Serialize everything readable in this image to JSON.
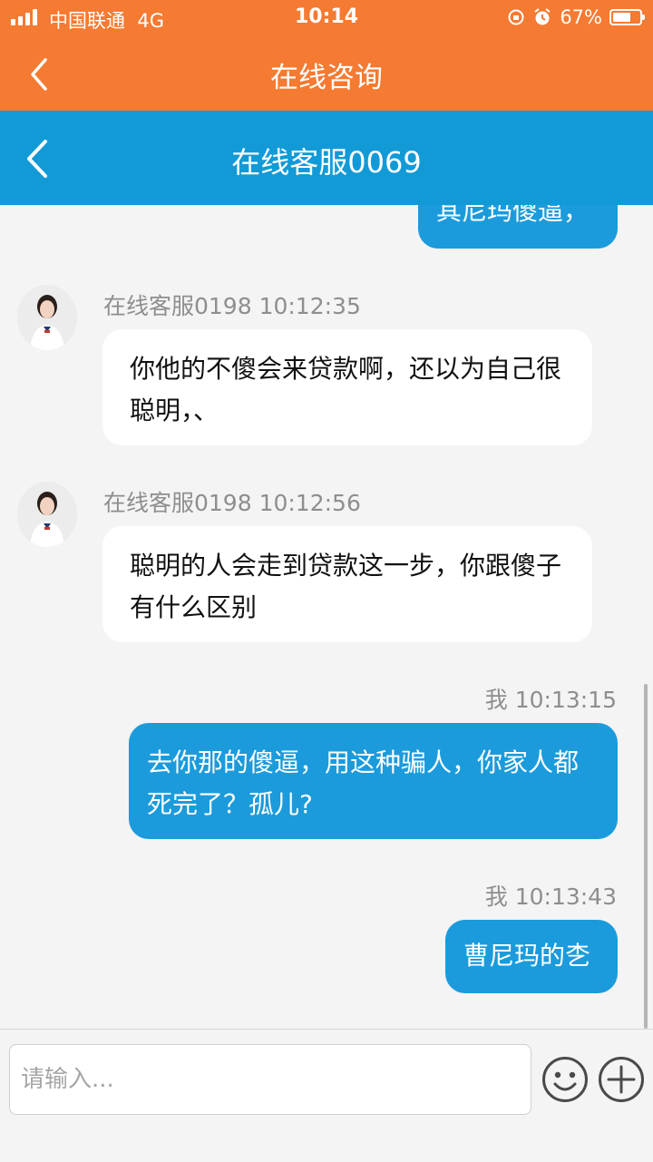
{
  "status_bar": {
    "carrier": "中国联通",
    "network": "4G",
    "time": "10:14",
    "battery_percent": "67%",
    "battery_level": 0.67
  },
  "outer_header": {
    "title": "在线咨询",
    "back_icon": "chevron-left-icon"
  },
  "inner_header": {
    "title": "在线客服0069",
    "back_icon": "chevron-left-icon"
  },
  "messages": [
    {
      "from": "me",
      "text": "其尼玛傻逼，"
    },
    {
      "from": "agent",
      "sender": "在线客服0198 10:12:35",
      "text": "你他的不傻会来贷款啊，还以为自己很聪明，、"
    },
    {
      "from": "agent",
      "sender": "在线客服0198 10:12:56",
      "text": "聪明的人会走到贷款这一步，你跟傻子有什么区别"
    },
    {
      "from": "me",
      "sender": "我 10:13:15",
      "text": "去你那的傻逼，用这种骗人，你家人都死完了？孤儿?"
    },
    {
      "from": "me",
      "sender": "我 10:13:43",
      "text": "曹尼玛的朰"
    }
  ],
  "input": {
    "placeholder": "请输入...",
    "value": ""
  },
  "icons": {
    "emoji": "smiley-icon",
    "add": "plus-circle-icon"
  },
  "colors": {
    "orange_header": "#f57a32",
    "blue_header": "#129ad7",
    "my_bubble": "#1b9bdc",
    "agent_bubble": "#ffffff"
  }
}
